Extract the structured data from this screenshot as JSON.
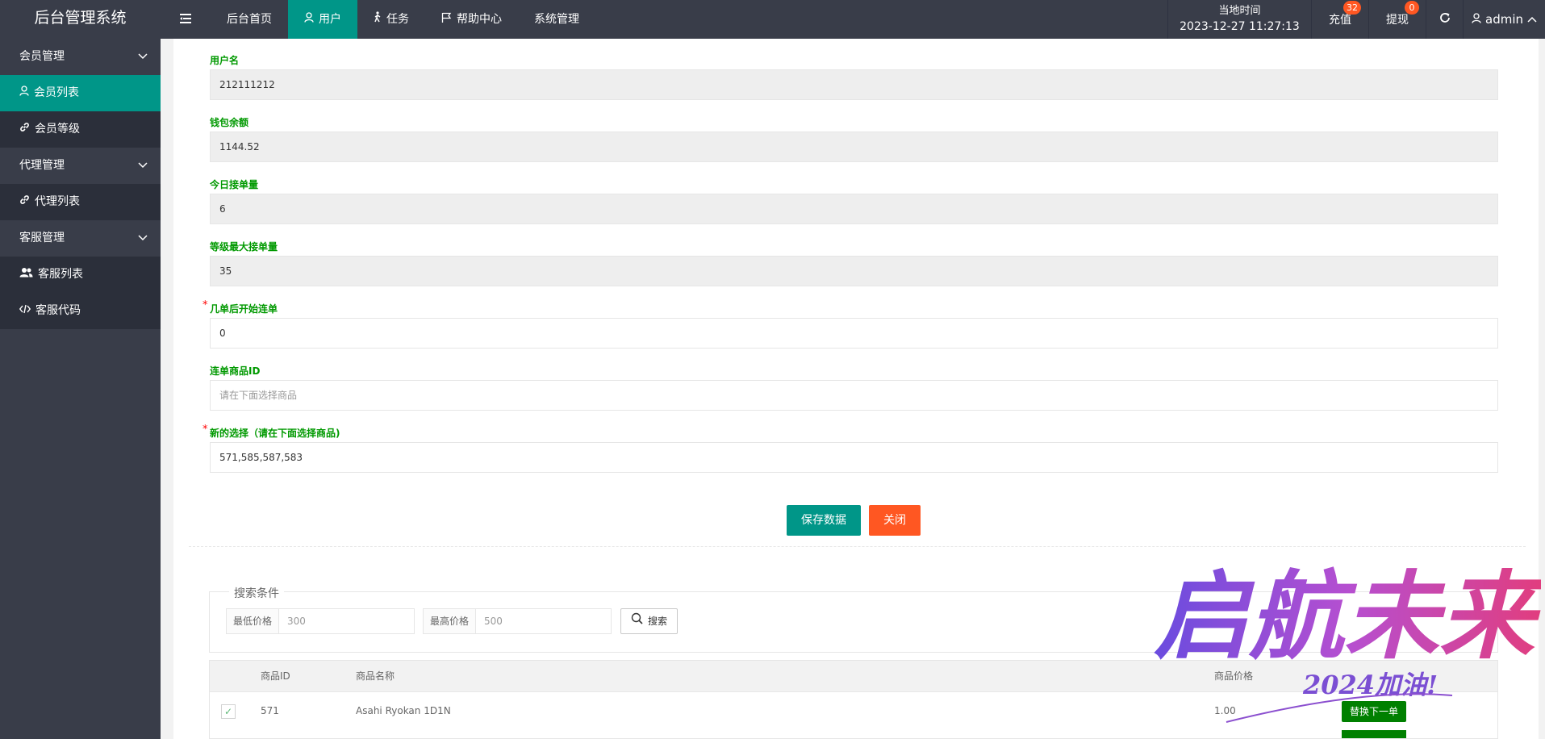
{
  "header": {
    "logo": "后台管理系统",
    "nav": [
      {
        "label": "后台首页"
      },
      {
        "label": "用户",
        "active": true
      },
      {
        "label": "任务"
      },
      {
        "label": "帮助中心"
      },
      {
        "label": "系统管理"
      }
    ],
    "time_label": "当地时间",
    "time_value": "2023-12-27 11:27:13",
    "recharge": {
      "label": "充值",
      "badge": "32"
    },
    "withdraw": {
      "label": "提现",
      "badge": "0"
    },
    "user": "admin"
  },
  "sidebar": {
    "groups": [
      {
        "label": "会员管理",
        "items": [
          {
            "label": "会员列表",
            "active": true
          },
          {
            "label": "会员等级"
          }
        ]
      },
      {
        "label": "代理管理",
        "items": [
          {
            "label": "代理列表"
          }
        ]
      },
      {
        "label": "客服管理",
        "items": [
          {
            "label": "客服列表"
          },
          {
            "label": "客服代码"
          }
        ]
      }
    ]
  },
  "form": {
    "username": {
      "label": "用户名",
      "value": "212111212"
    },
    "balance": {
      "label": "钱包余额",
      "value": "1144.52"
    },
    "today_orders": {
      "label": "今日接单量",
      "value": "6"
    },
    "max_orders": {
      "label": "等级最大接单量",
      "value": "35"
    },
    "start_after": {
      "label": "几单后开始连单",
      "value": "0"
    },
    "product_id": {
      "label": "连单商品ID",
      "placeholder": "请在下面选择商品"
    },
    "new_selection": {
      "label": "新的选择（请在下面选择商品)",
      "value": "571,585,587,583"
    },
    "save_label": "保存数据",
    "close_label": "关闭"
  },
  "search": {
    "legend": "搜索条件",
    "min_label": "最低价格",
    "min_placeholder": "300",
    "max_label": "最高价格",
    "max_placeholder": "500",
    "button_label": "搜索"
  },
  "table": {
    "columns": [
      "商品ID",
      "商品名称",
      "商品价格"
    ],
    "rows": [
      {
        "id": "571",
        "name": "Asahi Ryokan 1D1N",
        "price": "1.00",
        "action": "替换下一单",
        "checked": true
      }
    ]
  },
  "watermark": {
    "main": "启航未来",
    "sub": "2024加油!"
  },
  "colors": {
    "header_bg": "#393d49",
    "accent": "#009688",
    "danger": "#ff5722",
    "label_green": "#009900",
    "action_green": "#008000"
  }
}
